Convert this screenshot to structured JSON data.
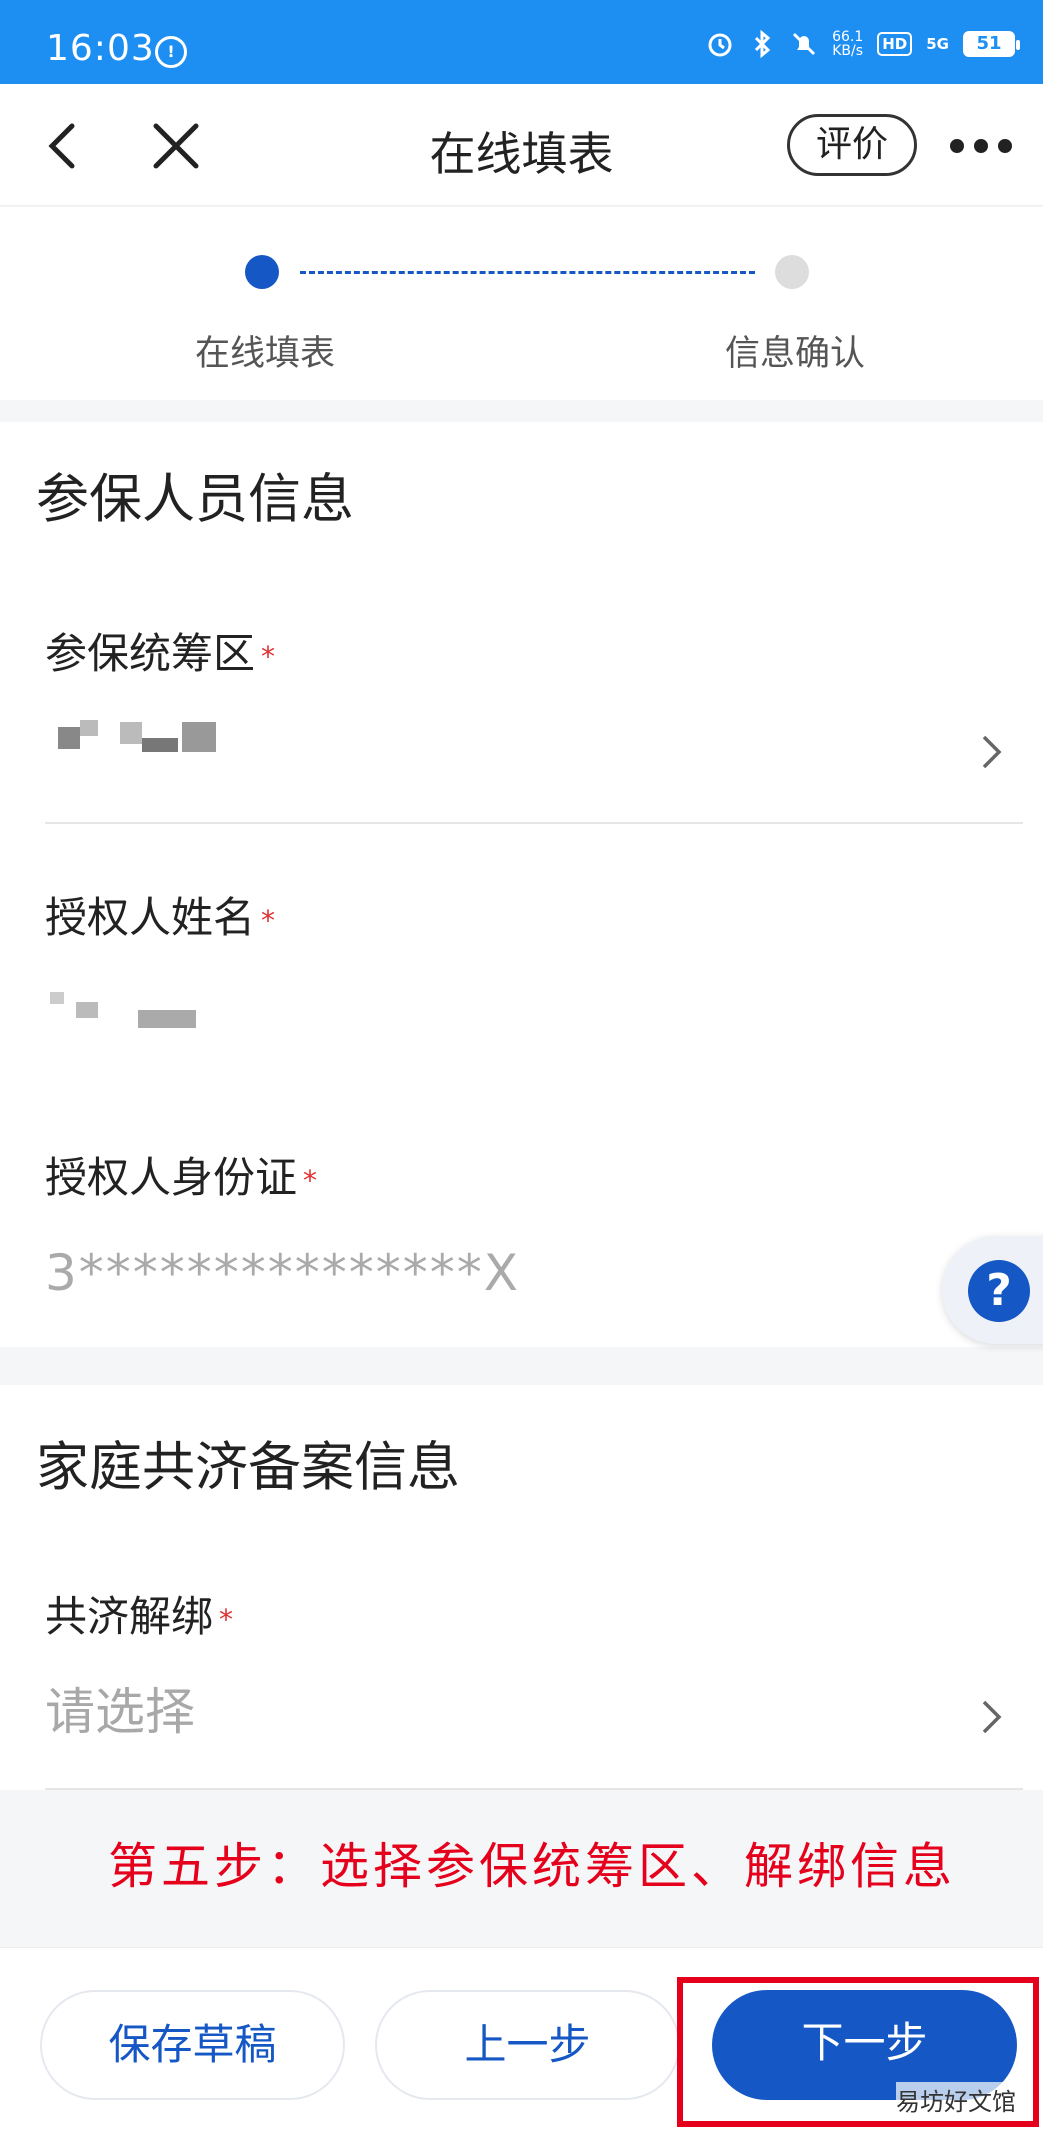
{
  "status_bar": {
    "time": "16:03",
    "speed_value": "66.1",
    "speed_unit": "KB/s",
    "hd": "HD",
    "network": "5G",
    "battery": "51"
  },
  "nav": {
    "title": "在线填表",
    "rate_label": "评价"
  },
  "stepper": {
    "steps": [
      {
        "label": "在线填表",
        "active": true
      },
      {
        "label": "信息确认",
        "active": false
      }
    ]
  },
  "insured_section": {
    "title": "参保人员信息",
    "fields": [
      {
        "label": "参保统筹区",
        "required_mark": "*",
        "value": ""
      },
      {
        "label": "授权人姓名",
        "required_mark": "*",
        "value": ""
      },
      {
        "label": "授权人身份证",
        "required_mark": "*",
        "value": "3***************X"
      }
    ]
  },
  "family_section": {
    "title": "家庭共济备案信息",
    "fields": [
      {
        "label": "共济解绑",
        "required_mark": "*",
        "placeholder": "请选择"
      }
    ]
  },
  "help_button": "?",
  "annotation": "第五步：选择参保统筹区、解绑信息",
  "buttons": {
    "save_draft": "保存草稿",
    "prev": "上一步",
    "next": "下一步"
  },
  "watermark": "易坊好文馆",
  "colors": {
    "status_bar": "#1e8ff2",
    "primary": "#1557c4",
    "annotation_red": "#e5001c"
  }
}
